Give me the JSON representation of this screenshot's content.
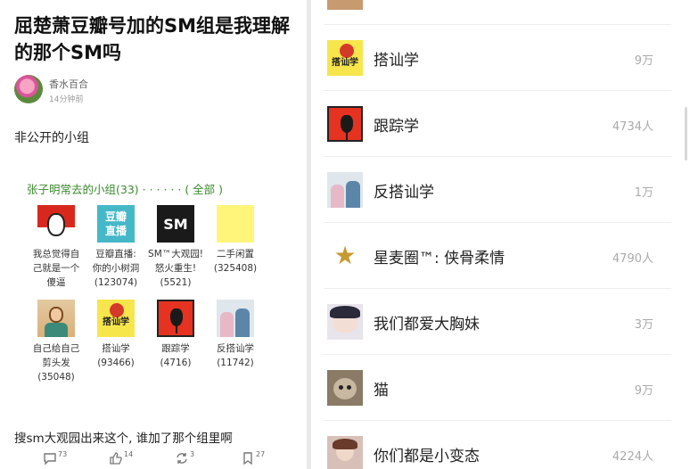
{
  "post": {
    "title": "屈楚萧豆瓣号加的SM组是我理解的那个SM吗",
    "author": "香水百合",
    "time": "14分钟前",
    "body": "非公开的小组",
    "groups_header": "张子明常去的小组(33)",
    "groups_all": "· · · · · · ( 全部 )",
    "groups": [
      {
        "line1": "我总觉得自",
        "line2": "己就是一个",
        "line3": "傻逼",
        "icon": "flag-face-icon"
      },
      {
        "line1": "豆瓣直播:",
        "line2": "你的小树洞",
        "line3": "(123074)",
        "icon": "douban-live-icon",
        "thumb_l1": "豆瓣",
        "thumb_l2": "直播"
      },
      {
        "line1": "SM™大观园!",
        "line2": "怒火重生!",
        "line3": "(5521)",
        "icon": "sm-logo-icon",
        "thumb_text": "SM"
      },
      {
        "line1": "二手闲置",
        "line2": "(325408)",
        "line3": "",
        "icon": "yellow-square-icon"
      },
      {
        "line1": "自己给自己",
        "line2": "剪头发",
        "line3": "(35048)",
        "icon": "girl-avatar-icon"
      },
      {
        "line1": "搭讪学",
        "line2": "(93466)",
        "line3": "",
        "icon": "book-cover-icon",
        "thumb_text": "搭讪学"
      },
      {
        "line1": "跟踪学",
        "line2": "(4716)",
        "line3": "",
        "icon": "red-figure-icon"
      },
      {
        "line1": "反搭讪学",
        "line2": "(11742)",
        "line3": "",
        "icon": "people-icon"
      }
    ],
    "footer_text": "搜sm大观园出来这个, 谁加了那个组里啊",
    "actions": {
      "comments": "73",
      "likes": "14",
      "reposts": "3",
      "saves": "27"
    }
  },
  "right_list": [
    {
      "name": "搭讪学",
      "count": "9万",
      "icon": "book-cover-icon",
      "thumb_text": "搭讪学"
    },
    {
      "name": "跟踪学",
      "count": "4734人",
      "icon": "red-figure-icon"
    },
    {
      "name": "反搭讪学",
      "count": "1万",
      "icon": "people-icon"
    },
    {
      "name": "星麦圈™: 侠骨柔情",
      "count": "4790人",
      "icon": "gold-star-icon",
      "thumb_text": "★"
    },
    {
      "name": "我们都爱大胸妹",
      "count": "3万",
      "icon": "anime-girl-icon"
    },
    {
      "name": "猫",
      "count": "9万",
      "icon": "cat-icon"
    },
    {
      "name": "你们都是小变态",
      "count": "4224人",
      "icon": "anime-char-icon"
    }
  ]
}
